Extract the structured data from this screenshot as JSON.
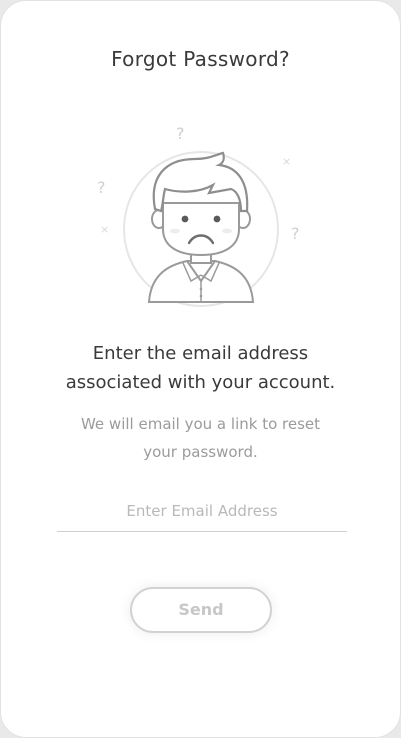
{
  "screen": {
    "title": "Forgot Password?"
  },
  "illustration": {
    "description_icon": "confused-person-icon"
  },
  "message": {
    "headline_line1": "Enter the email address",
    "headline_line2": "associated with your account.",
    "sub_line1": "We will email you a link to reset",
    "sub_line2": "your password."
  },
  "form": {
    "email_placeholder": "Enter Email Address",
    "email_value": "",
    "send_label": "Send"
  },
  "colors": {
    "background": "#ffffff",
    "title": "#3a3a3a",
    "subtitle": "#9b9b9b",
    "placeholder": "#b9b9b9",
    "button_border": "#d2d2d2"
  }
}
